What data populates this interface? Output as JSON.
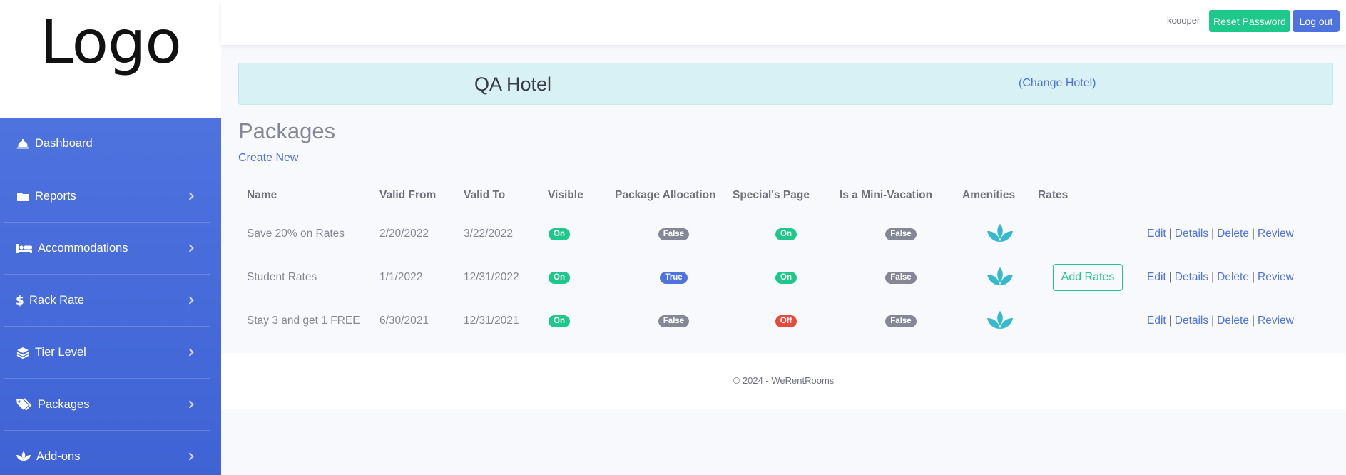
{
  "logo": {
    "text": "Logo"
  },
  "sidebar": {
    "items": [
      {
        "label": "Dashboard",
        "icon": "bell-concierge-icon",
        "has_chevron": false
      },
      {
        "label": "Reports",
        "icon": "folder-icon",
        "has_chevron": true
      },
      {
        "label": "Accommodations",
        "icon": "bed-icon",
        "has_chevron": true
      },
      {
        "label": "Rack Rate",
        "icon": "dollar-icon",
        "has_chevron": true
      },
      {
        "label": "Tier Level",
        "icon": "layers-icon",
        "has_chevron": true
      },
      {
        "label": "Packages",
        "icon": "tags-icon",
        "has_chevron": true
      },
      {
        "label": "Add-ons",
        "icon": "spa-icon",
        "has_chevron": true
      }
    ]
  },
  "topbar": {
    "username": "kcooper",
    "reset_password": "Reset Password",
    "logout": "Log out"
  },
  "hotel": {
    "name": "QA Hotel",
    "change_link": "(Change Hotel)"
  },
  "page": {
    "title": "Packages",
    "create_new": "Create New"
  },
  "table": {
    "headers": {
      "name": "Name",
      "valid_from": "Valid From",
      "valid_to": "Valid To",
      "visible": "Visible",
      "allocation": "Package Allocation",
      "specials": "Special's Page",
      "mini": "Is a Mini-Vacation",
      "amenities": "Amenities",
      "rates": "Rates"
    },
    "rows": [
      {
        "name": "Save 20% on Rates",
        "valid_from": "2/20/2022",
        "valid_to": "3/22/2022",
        "visible": "On",
        "allocation": "False",
        "specials": "On",
        "mini": "False",
        "add_rates": ""
      },
      {
        "name": "Student Rates",
        "valid_from": "1/1/2022",
        "valid_to": "12/31/2022",
        "visible": "On",
        "allocation": "True",
        "specials": "On",
        "mini": "False",
        "add_rates": "Add Rates"
      },
      {
        "name": "Stay 3 and get 1 FREE",
        "valid_from": "6/30/2021",
        "valid_to": "12/31/2021",
        "visible": "On",
        "allocation": "False",
        "specials": "Off",
        "mini": "False",
        "add_rates": ""
      }
    ],
    "actions": {
      "edit": "Edit",
      "details": "Details",
      "delete": "Delete",
      "review": "Review",
      "separator": "|"
    }
  },
  "footer": {
    "text": "© 2024 - WeRentRooms"
  },
  "colors": {
    "primary": "#4e73df",
    "success": "#1cc88a",
    "danger": "#e74a3b",
    "secondary": "#858796",
    "info": "#36b9cc"
  }
}
